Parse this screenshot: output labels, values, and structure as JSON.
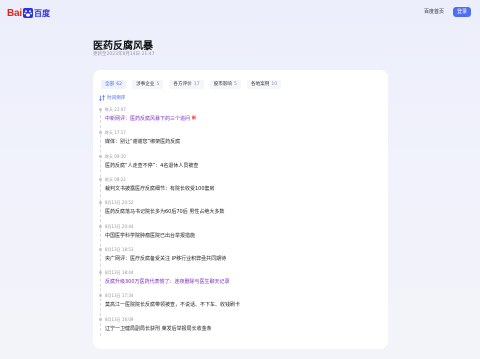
{
  "header": {
    "logo_text": "Bai",
    "logo_text_cn": "百度",
    "nav_home": "百度首页",
    "login": "登录",
    "brand_red": "#e1251b",
    "brand_blue": "#4e6ef2"
  },
  "page": {
    "title": "医药反腐风暴",
    "meta": "更新至2023年8月14日 21:47"
  },
  "tabs": [
    {
      "label": "全部",
      "count": "62",
      "active": true
    },
    {
      "label": "涉事企业",
      "count": "5",
      "active": false
    },
    {
      "label": "各方评价",
      "count": "17",
      "active": false
    },
    {
      "label": "股市影响",
      "count": "5",
      "active": false
    },
    {
      "label": "各地案例",
      "count": "10",
      "active": false
    }
  ],
  "sort_label": "时间倒序",
  "timeline": [
    {
      "time": "昨天 21:47",
      "text": "中新网评：医药反腐风暴下的三个追问",
      "highlight": true,
      "badge": "新"
    },
    {
      "time": "昨天 17:17",
      "text": "媒体：别让“谢谢您”绑架医药反腐",
      "highlight": false,
      "badge": ""
    },
    {
      "time": "昨天 09:10",
      "text": "医药反腐“人走查不停”：4名退休人员被查",
      "highlight": false,
      "badge": ""
    },
    {
      "time": "昨天 08:22",
      "text": "裁判文书披露医疗反腐细节：有院长收受100套房",
      "highlight": false,
      "badge": ""
    },
    {
      "time": "8月13日 20:52",
      "text": "医药反腐落马书记院长多为60后70后 男性占绝大多数",
      "highlight": false,
      "badge": ""
    },
    {
      "time": "8月13日 20:44",
      "text": "中国医学科学院肿瘤医院已出台举报措施",
      "highlight": false,
      "badge": ""
    },
    {
      "time": "8月13日 18:53",
      "text": "央广网评：医疗反腐备受关注 IP移行业积弊亟共同期待",
      "highlight": false,
      "badge": ""
    },
    {
      "time": "8月13日 18:44",
      "text": "反腐升级300万医药代表慌了：连夜删除与医生聊天记录",
      "highlight": true,
      "badge": ""
    },
    {
      "time": "8月13日 17:34",
      "text": "莫高江一医院院长反腐带领被查，不说话、不下车、收钱刷卡",
      "highlight": false,
      "badge": ""
    },
    {
      "time": "8月13日 16:09",
      "text": "辽宁一卫健局副局长获刑 莱发后举报局长收金条",
      "highlight": false,
      "badge": ""
    }
  ]
}
